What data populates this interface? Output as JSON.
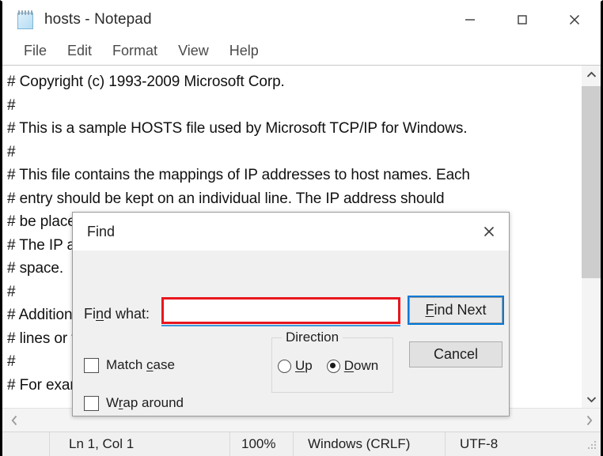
{
  "window": {
    "title": "hosts - Notepad",
    "icon": "notepad-icon",
    "controls": {
      "minimize": "—",
      "maximize": "□",
      "close": "✕"
    }
  },
  "menubar": {
    "items": [
      {
        "label": "File"
      },
      {
        "label": "Edit"
      },
      {
        "label": "Format"
      },
      {
        "label": "View"
      },
      {
        "label": "Help"
      }
    ]
  },
  "editor": {
    "lines": [
      "# Copyright (c) 1993-2009 Microsoft Corp.",
      "#",
      "# This is a sample HOSTS file used by Microsoft TCP/IP for Windows.",
      "#",
      "# This file contains the mappings of IP addresses to host names. Each",
      "# entry should be kept on an individual line. The IP address should",
      "# be placed in the first column followed by the corresponding host name.",
      "# The IP address and the host name should be separated by at least one",
      "# space.",
      "#",
      "# Additionally, comments (such as these) may be inserted on individual",
      "# lines or following the machine name denoted by a '#' symbol.",
      "#",
      "# For example:"
    ]
  },
  "scrollbars": {
    "vertical": {
      "up_arrow": "⌃",
      "down_arrow": "⌄"
    },
    "horizontal": {
      "left_arrow": "‹",
      "right_arrow": "›"
    }
  },
  "statusbar": {
    "position": "Ln 1, Col 1",
    "zoom": "100%",
    "line_endings": "Windows (CRLF)",
    "encoding": "UTF-8"
  },
  "find_dialog": {
    "title": "Find",
    "close_label": "✕",
    "find_what_label": "Find what:",
    "find_what_value": "",
    "find_what_placeholder": "",
    "buttons": {
      "find_next": "Find Next",
      "cancel": "Cancel"
    },
    "direction": {
      "legend": "Direction",
      "options": [
        {
          "label": "Up",
          "selected": false
        },
        {
          "label": "Down",
          "selected": true
        }
      ]
    },
    "checkboxes": [
      {
        "label": "Match case",
        "checked": false
      },
      {
        "label": "Wrap around",
        "checked": false
      }
    ],
    "highlight_color": "#e8161f",
    "focus_color": "#0078d7"
  }
}
